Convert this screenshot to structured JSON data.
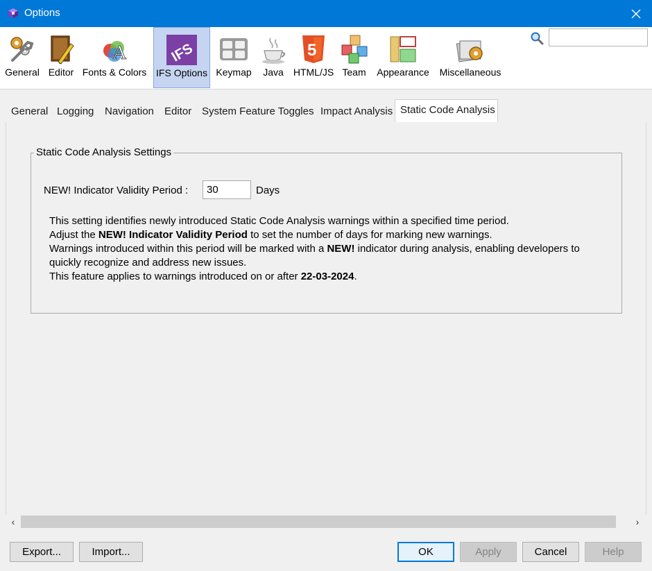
{
  "window": {
    "title": "Options",
    "app_icon": "netbeans-cube-icon",
    "close_icon": "close-x-icon"
  },
  "categories": [
    {
      "label": "General",
      "icon": "gears-wrench-icon"
    },
    {
      "label": "Editor",
      "icon": "book-pencil-icon"
    },
    {
      "label": "Fonts & Colors",
      "icon": "font-palette-icon"
    },
    {
      "label": "IFS Options",
      "icon": "ifs-logo-icon",
      "selected": true
    },
    {
      "label": "Keymap",
      "icon": "keyboard-icon"
    },
    {
      "label": "Java",
      "icon": "java-coffee-cup-icon"
    },
    {
      "label": "HTML/JS",
      "icon": "html5-shield-icon"
    },
    {
      "label": "Team",
      "icon": "team-cubes-icon"
    },
    {
      "label": "Appearance",
      "icon": "appearance-panels-icon"
    },
    {
      "label": "Miscellaneous",
      "icon": "misc-stack-gear-icon"
    }
  ],
  "search": {
    "value": "",
    "placeholder": "",
    "icon": "search-icon"
  },
  "tabs": [
    {
      "label": "General"
    },
    {
      "label": "Logging"
    },
    {
      "label": "Navigation"
    },
    {
      "label": "Editor"
    },
    {
      "label": "System Feature Toggles"
    },
    {
      "label": "Impact Analysis"
    },
    {
      "label": "Static Code Analysis",
      "active": true
    }
  ],
  "group": {
    "title": "Static Code Analysis Settings",
    "field_label": "NEW! Indicator Validity Period :",
    "field_value": "30",
    "field_unit": "Days",
    "description": {
      "line1": "This setting identifies newly introduced Static Code Analysis warnings within a specified time period.",
      "line2_pre": "Adjust the ",
      "line2_bold": "NEW! Indicator Validity Period",
      "line2_post": " to set the number of days for marking new warnings.",
      "line3_pre": "Warnings introduced within this period will be marked with a ",
      "line3_bold": "NEW!",
      "line3_post": " indicator during analysis, enabling developers to",
      "line4": "quickly recognize and address new issues.",
      "line5_pre": "This feature applies to warnings introduced on or after ",
      "line5_bold": "22-03-2024",
      "line5_post": "."
    }
  },
  "scrollbar": {
    "left_icon": "chevron-left-icon",
    "right_icon": "chevron-right-icon",
    "left_glyph": "‹",
    "right_glyph": "›"
  },
  "buttons": {
    "export": "Export...",
    "import": "Import...",
    "ok": "OK",
    "apply": "Apply",
    "cancel": "Cancel",
    "help": "Help"
  }
}
